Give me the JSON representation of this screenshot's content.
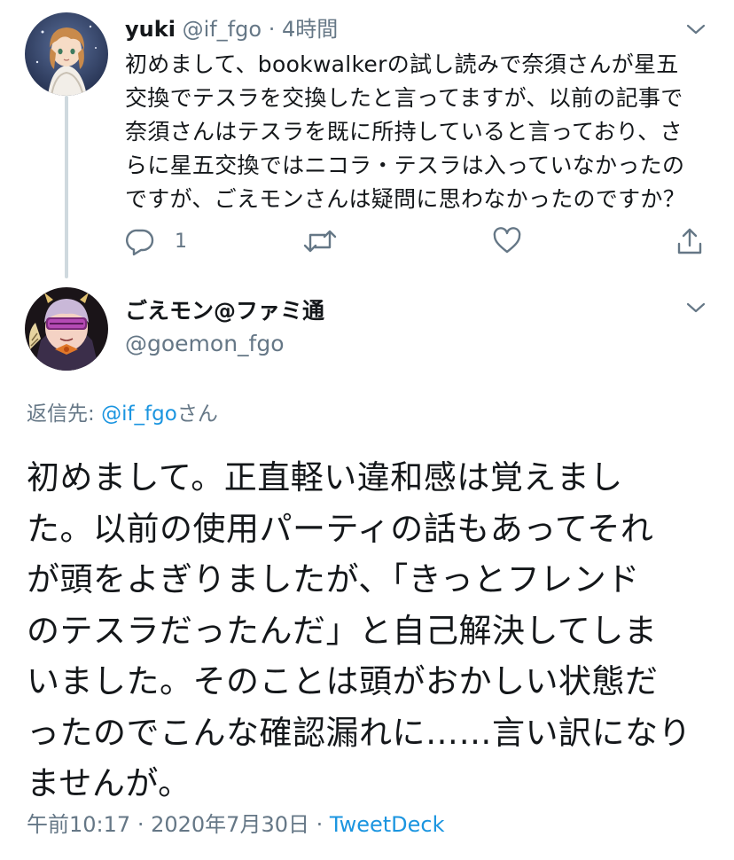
{
  "parent_tweet": {
    "display_name": "yuki",
    "handle": "@if_fgo",
    "separator": "·",
    "time_ago": "4時間",
    "text": "初めまして、bookwalkerの試し読みで奈須さんが星五\n交換でテスラを交換したと言ってますが、以前の記事で\n奈須さんはテスラを既に所持していると言っており、さ\nらに星五交換ではニコラ・テスラは入っていなかったの\nですが、ごえモンさんは疑問に思わなかったのですか？",
    "reply_count": "1",
    "icons": [
      "reply-icon",
      "retweet-icon",
      "like-icon",
      "share-icon",
      "chevron-down-icon"
    ]
  },
  "main_tweet": {
    "display_name": "ごえモン@ファミ通",
    "handle": "@goemon_fgo",
    "reply_prefix": "返信先: ",
    "reply_mention": "@if_fgo",
    "reply_suffix": "さん",
    "text": "初めまして。正直軽い違和感は覚えまし\nた。以前の使用パーティの話もあってそれ\nが頭をよぎりましたが、「きっとフレンド\nのテスラだったんだ」と自己解決してしま\nいました。そのことは頭がおかしい状態だ\nったのでこんな確認漏れに……言い訳になり\nませんが。",
    "time": "午前10:17",
    "date": "2020年7月30日",
    "separator": "·",
    "source": "TweetDeck"
  },
  "colors": {
    "text_primary": "#14171a",
    "text_secondary": "#657786",
    "link": "#1b95e0",
    "thread_line": "#cfd9de"
  }
}
